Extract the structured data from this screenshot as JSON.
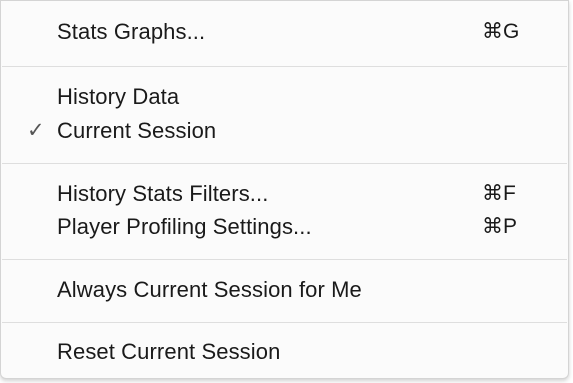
{
  "menu": {
    "items": [
      {
        "label": "Stats Graphs...",
        "shortcut": "⌘G"
      },
      {
        "label": "History Data"
      },
      {
        "label": "Current Session",
        "check": "✓"
      },
      {
        "label": "History Stats Filters...",
        "shortcut": "⌘F"
      },
      {
        "label": "Player Profiling Settings...",
        "shortcut": "⌘P"
      },
      {
        "label": "Always Current Session for Me"
      },
      {
        "label": "Reset Current Session"
      }
    ]
  }
}
